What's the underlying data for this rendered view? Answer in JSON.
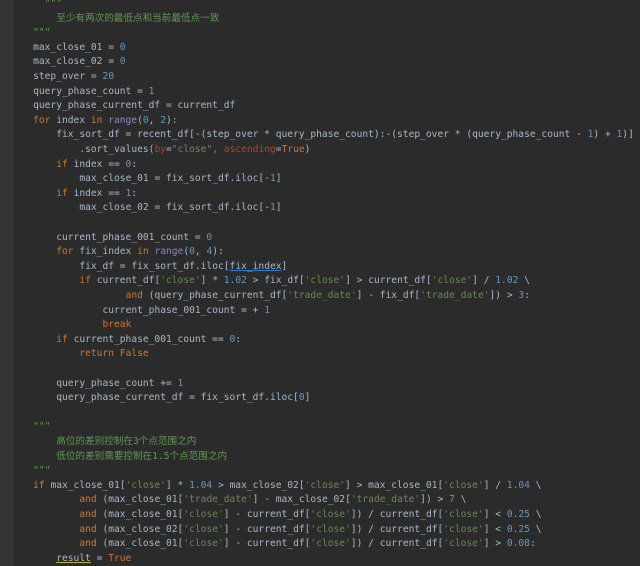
{
  "editor": {
    "lines": [
      {
        "indent": 6,
        "tokens": [
          {
            "t": "\"\"\"",
            "c": "doc"
          }
        ]
      },
      {
        "indent": 8,
        "tokens": [
          {
            "t": "至少有两次的最低点和当前最低点一致",
            "c": "doc"
          }
        ]
      },
      {
        "indent": 4,
        "tokens": [
          {
            "t": "\"\"\"",
            "c": "doc"
          }
        ]
      },
      {
        "indent": 4,
        "tokens": [
          {
            "t": "max_close_01 = ",
            "c": "nm"
          },
          {
            "t": "0",
            "c": "num"
          }
        ]
      },
      {
        "indent": 4,
        "tokens": [
          {
            "t": "max_close_02 = ",
            "c": "nm"
          },
          {
            "t": "0",
            "c": "num"
          }
        ]
      },
      {
        "indent": 4,
        "tokens": [
          {
            "t": "step_over = ",
            "c": "nm"
          },
          {
            "t": "20",
            "c": "num"
          }
        ]
      },
      {
        "indent": 4,
        "tokens": [
          {
            "t": "query_phase_count = ",
            "c": "nm"
          },
          {
            "t": "1",
            "c": "num"
          }
        ]
      },
      {
        "indent": 4,
        "tokens": [
          {
            "t": "query_phase_current_df = current_df",
            "c": "nm"
          }
        ]
      },
      {
        "indent": 4,
        "tokens": [
          {
            "t": "for ",
            "c": "kw"
          },
          {
            "t": "index ",
            "c": "nm"
          },
          {
            "t": "in ",
            "c": "kw"
          },
          {
            "t": "range",
            "c": "bi"
          },
          {
            "t": "(",
            "c": "nm"
          },
          {
            "t": "0",
            "c": "num"
          },
          {
            "t": ", ",
            "c": "nm"
          },
          {
            "t": "2",
            "c": "num"
          },
          {
            "t": "):",
            "c": "nm"
          }
        ]
      },
      {
        "indent": 8,
        "tokens": [
          {
            "t": "fix_sort_df = recent_df[-(step_over * query_phase_count):-(step_over * (query_phase_count - ",
            "c": "nm"
          },
          {
            "t": "1",
            "c": "num"
          },
          {
            "t": ") + ",
            "c": "nm"
          },
          {
            "t": "1",
            "c": "num"
          },
          {
            "t": ")] \\",
            "c": "nm"
          }
        ]
      },
      {
        "indent": 12,
        "tokens": [
          {
            "t": ".sort_values(",
            "c": "nm"
          },
          {
            "t": "by",
            "c": "kwarg"
          },
          {
            "t": "=",
            "c": "nm"
          },
          {
            "t": "\"close\"",
            "c": "str"
          },
          {
            "t": ", ",
            "c": "kw"
          },
          {
            "t": "ascending",
            "c": "kwarg"
          },
          {
            "t": "=",
            "c": "nm"
          },
          {
            "t": "True",
            "c": "kw"
          },
          {
            "t": ")",
            "c": "nm"
          }
        ]
      },
      {
        "indent": 8,
        "tokens": [
          {
            "t": "if ",
            "c": "kw"
          },
          {
            "t": "index == ",
            "c": "nm"
          },
          {
            "t": "0",
            "c": "num"
          },
          {
            "t": ":",
            "c": "nm"
          }
        ]
      },
      {
        "indent": 12,
        "tokens": [
          {
            "t": "max_close_01 = fix_sort_df.iloc[-",
            "c": "nm"
          },
          {
            "t": "1",
            "c": "num"
          },
          {
            "t": "]",
            "c": "nm"
          }
        ]
      },
      {
        "indent": 8,
        "tokens": [
          {
            "t": "if ",
            "c": "kw"
          },
          {
            "t": "index == ",
            "c": "nm"
          },
          {
            "t": "1",
            "c": "num"
          },
          {
            "t": ":",
            "c": "nm"
          }
        ]
      },
      {
        "indent": 12,
        "tokens": [
          {
            "t": "max_close_02 = fix_sort_df.iloc[-",
            "c": "nm"
          },
          {
            "t": "1",
            "c": "num"
          },
          {
            "t": "]",
            "c": "nm"
          }
        ]
      },
      {
        "indent": 0,
        "tokens": []
      },
      {
        "indent": 8,
        "tokens": [
          {
            "t": "current_phase_001_count = ",
            "c": "nm"
          },
          {
            "t": "0",
            "c": "num"
          }
        ]
      },
      {
        "indent": 8,
        "tokens": [
          {
            "t": "for ",
            "c": "kw"
          },
          {
            "t": "fix_index ",
            "c": "nm"
          },
          {
            "t": "in ",
            "c": "kw"
          },
          {
            "t": "range",
            "c": "bi"
          },
          {
            "t": "(",
            "c": "nm"
          },
          {
            "t": "0",
            "c": "num"
          },
          {
            "t": ", ",
            "c": "nm"
          },
          {
            "t": "4",
            "c": "num"
          },
          {
            "t": "):",
            "c": "nm"
          }
        ]
      },
      {
        "indent": 12,
        "tokens": [
          {
            "t": "fix_df = fix_sort_df.iloc[",
            "c": "nm"
          },
          {
            "t": "fix_index",
            "c": "link"
          },
          {
            "t": "]",
            "c": "nm"
          }
        ]
      },
      {
        "indent": 12,
        "tokens": [
          {
            "t": "if ",
            "c": "kw"
          },
          {
            "t": "current_df[",
            "c": "nm"
          },
          {
            "t": "'close'",
            "c": "str"
          },
          {
            "t": "] * ",
            "c": "nm"
          },
          {
            "t": "1.02",
            "c": "num"
          },
          {
            "t": " > fix_df[",
            "c": "nm"
          },
          {
            "t": "'close'",
            "c": "str"
          },
          {
            "t": "] > current_df[",
            "c": "nm"
          },
          {
            "t": "'close'",
            "c": "str"
          },
          {
            "t": "] / ",
            "c": "nm"
          },
          {
            "t": "1.02",
            "c": "num"
          },
          {
            "t": " \\",
            "c": "nm"
          }
        ]
      },
      {
        "indent": 20,
        "tokens": [
          {
            "t": "and ",
            "c": "kw"
          },
          {
            "t": "(query_phase_current_df[",
            "c": "nm"
          },
          {
            "t": "'trade_date'",
            "c": "str"
          },
          {
            "t": "] - fix_df[",
            "c": "nm"
          },
          {
            "t": "'trade_date'",
            "c": "str"
          },
          {
            "t": "]) > ",
            "c": "nm"
          },
          {
            "t": "3",
            "c": "num"
          },
          {
            "t": ":",
            "c": "nm"
          }
        ]
      },
      {
        "indent": 16,
        "tokens": [
          {
            "t": "current_phase_001_count = + ",
            "c": "nm"
          },
          {
            "t": "1",
            "c": "num"
          }
        ]
      },
      {
        "indent": 16,
        "tokens": [
          {
            "t": "break",
            "c": "kw"
          }
        ]
      },
      {
        "indent": 8,
        "tokens": [
          {
            "t": "if ",
            "c": "kw"
          },
          {
            "t": "current_phase_001_count == ",
            "c": "nm"
          },
          {
            "t": "0",
            "c": "num"
          },
          {
            "t": ":",
            "c": "nm"
          }
        ]
      },
      {
        "indent": 12,
        "tokens": [
          {
            "t": "return ",
            "c": "kw"
          },
          {
            "t": "False",
            "c": "kw"
          }
        ]
      },
      {
        "indent": 0,
        "tokens": []
      },
      {
        "indent": 8,
        "tokens": [
          {
            "t": "query_phase_count += ",
            "c": "nm"
          },
          {
            "t": "1",
            "c": "num"
          }
        ]
      },
      {
        "indent": 8,
        "tokens": [
          {
            "t": "query_phase_current_df = fix_sort_df.iloc[",
            "c": "nm"
          },
          {
            "t": "0",
            "c": "num"
          },
          {
            "t": "]",
            "c": "nm"
          }
        ]
      },
      {
        "indent": 0,
        "tokens": []
      },
      {
        "indent": 4,
        "tokens": [
          {
            "t": "\"\"\"",
            "c": "doc"
          }
        ]
      },
      {
        "indent": 8,
        "tokens": [
          {
            "t": "高位的差别控制在3个点范围之内",
            "c": "doc"
          }
        ]
      },
      {
        "indent": 8,
        "tokens": [
          {
            "t": "低位的差别需要控制在1.5个点范围之内",
            "c": "doc"
          }
        ]
      },
      {
        "indent": 4,
        "tokens": [
          {
            "t": "\"\"\"",
            "c": "doc"
          }
        ]
      },
      {
        "indent": 4,
        "tokens": [
          {
            "t": "if ",
            "c": "kw"
          },
          {
            "t": "max_close_01[",
            "c": "nm"
          },
          {
            "t": "'close'",
            "c": "str"
          },
          {
            "t": "] * ",
            "c": "nm"
          },
          {
            "t": "1.04",
            "c": "num"
          },
          {
            "t": " > max_close_02[",
            "c": "nm"
          },
          {
            "t": "'close'",
            "c": "str"
          },
          {
            "t": "] > max_close_01[",
            "c": "nm"
          },
          {
            "t": "'close'",
            "c": "str"
          },
          {
            "t": "] / ",
            "c": "nm"
          },
          {
            "t": "1.04",
            "c": "num"
          },
          {
            "t": " \\",
            "c": "nm"
          }
        ]
      },
      {
        "indent": 12,
        "tokens": [
          {
            "t": "and ",
            "c": "kw"
          },
          {
            "t": "(max_close_01[",
            "c": "nm"
          },
          {
            "t": "'trade_date'",
            "c": "str"
          },
          {
            "t": "] - max_close_02[",
            "c": "nm"
          },
          {
            "t": "'trade_date'",
            "c": "str"
          },
          {
            "t": "]) > ",
            "c": "nm"
          },
          {
            "t": "7",
            "c": "num"
          },
          {
            "t": " \\",
            "c": "nm"
          }
        ]
      },
      {
        "indent": 12,
        "tokens": [
          {
            "t": "and ",
            "c": "kw"
          },
          {
            "t": "(max_close_01[",
            "c": "nm"
          },
          {
            "t": "'close'",
            "c": "str"
          },
          {
            "t": "] - current_df[",
            "c": "nm"
          },
          {
            "t": "'close'",
            "c": "str"
          },
          {
            "t": "]) / current_df[",
            "c": "nm"
          },
          {
            "t": "'close'",
            "c": "str"
          },
          {
            "t": "] < ",
            "c": "nm"
          },
          {
            "t": "0.25",
            "c": "num"
          },
          {
            "t": " \\",
            "c": "nm"
          }
        ]
      },
      {
        "indent": 12,
        "tokens": [
          {
            "t": "and ",
            "c": "kw"
          },
          {
            "t": "(max_close_02[",
            "c": "nm"
          },
          {
            "t": "'close'",
            "c": "str"
          },
          {
            "t": "] - current_df[",
            "c": "nm"
          },
          {
            "t": "'close'",
            "c": "str"
          },
          {
            "t": "]) / current_df[",
            "c": "nm"
          },
          {
            "t": "'close'",
            "c": "str"
          },
          {
            "t": "] < ",
            "c": "nm"
          },
          {
            "t": "0.25",
            "c": "num"
          },
          {
            "t": " \\",
            "c": "nm"
          }
        ]
      },
      {
        "indent": 12,
        "tokens": [
          {
            "t": "and ",
            "c": "kw"
          },
          {
            "t": "(max_close_01[",
            "c": "nm"
          },
          {
            "t": "'close'",
            "c": "str"
          },
          {
            "t": "] - current_df[",
            "c": "nm"
          },
          {
            "t": "'close'",
            "c": "str"
          },
          {
            "t": "]) / current_df[",
            "c": "nm"
          },
          {
            "t": "'close'",
            "c": "str"
          },
          {
            "t": "] > ",
            "c": "nm"
          },
          {
            "t": "0.08",
            "c": "num"
          },
          {
            "t": ":",
            "c": "nm"
          }
        ]
      },
      {
        "indent": 8,
        "tokens": [
          {
            "t": "result",
            "c": "under"
          },
          {
            "t": " = ",
            "c": "nm"
          },
          {
            "t": "True",
            "c": "kw"
          }
        ]
      }
    ]
  },
  "colors": {
    "background": "#2b2b2b",
    "keyword": "#cc7832",
    "number": "#6897bb",
    "string": "#6a8759",
    "docstring": "#629755",
    "builtin": "#8888c6",
    "kwarg": "#aa4926",
    "text": "#a9b7c6"
  }
}
